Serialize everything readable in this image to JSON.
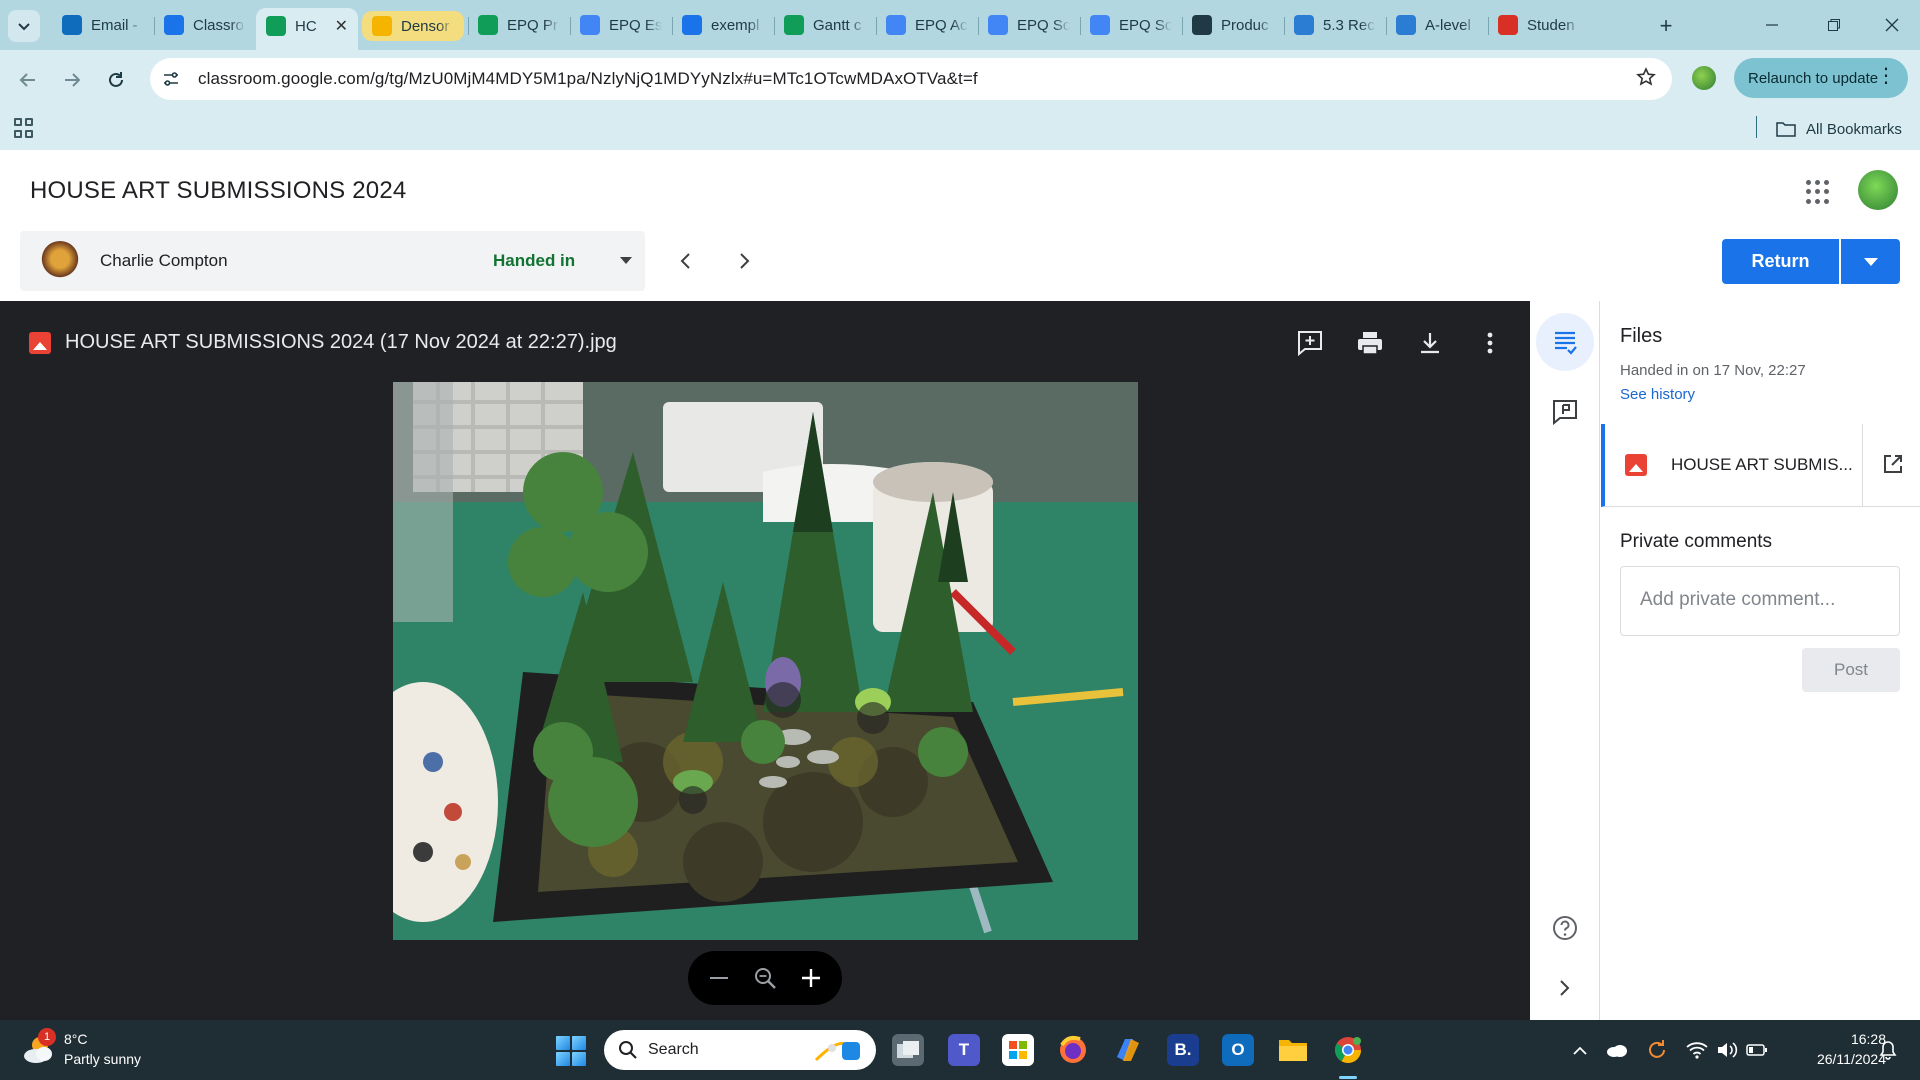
{
  "browser": {
    "tabs": [
      {
        "title": "Email -",
        "icon": "outlook-icon",
        "color": "#0f6cbd"
      },
      {
        "title": "Classro",
        "icon": "classroom-icon",
        "color": "#1a73e8"
      },
      {
        "title": "HC",
        "icon": "classroom-assignment-icon",
        "color": "#0f9d58",
        "active": true
      },
      {
        "title": "Densor",
        "icon": "slides-icon",
        "color": "#f4b400",
        "grouped": true
      },
      {
        "title": "EPQ Pr",
        "icon": "sheets-icon",
        "color": "#0f9d58"
      },
      {
        "title": "EPQ Es",
        "icon": "docs-icon",
        "color": "#4285f4"
      },
      {
        "title": "exempl",
        "icon": "pinterest-icon",
        "color": "#1a73e8"
      },
      {
        "title": "Gantt c",
        "icon": "sheets-icon",
        "color": "#0f9d58"
      },
      {
        "title": "EPQ Ac",
        "icon": "docs-icon",
        "color": "#4285f4"
      },
      {
        "title": "EPQ Sc",
        "icon": "docs-icon",
        "color": "#4285f4"
      },
      {
        "title": "EPQ Sc",
        "icon": "docs-icon",
        "color": "#4285f4"
      },
      {
        "title": "Produc",
        "icon": "search-q-icon",
        "color": "#1f3a44"
      },
      {
        "title": "5.3 Rec",
        "icon": "word-w-icon",
        "color": "#2b7cd3"
      },
      {
        "title": "A-level",
        "icon": "word-w-icon",
        "color": "#2b7cd3"
      },
      {
        "title": "Studen",
        "icon": "app-red-icon",
        "color": "#d93025"
      }
    ],
    "url": "classroom.google.com/g/tg/MzU0MjM4MDY5M1pa/NzlyNjQ1MDYyNzlx#u=MTc1OTcwMDAxOTVa&t=f",
    "relaunch_label": "Relaunch to update",
    "all_bookmarks_label": "All Bookmarks"
  },
  "header": {
    "title": "HOUSE ART SUBMISSIONS 2024"
  },
  "student": {
    "name": "Charlie Compton",
    "status": "Handed in",
    "status_color": "#137333"
  },
  "actions": {
    "return_label": "Return"
  },
  "viewer": {
    "file_name": "HOUSE ART SUBMISSIONS 2024 (17 Nov 2024 at 22:27).jpg",
    "background": "#202124"
  },
  "panel": {
    "files_heading": "Files",
    "handed_in_meta": "Handed in on 17 Nov, 22:27",
    "see_history": "See history",
    "attachment_name": "HOUSE ART SUBMIS...",
    "private_comments_heading": "Private comments",
    "comment_placeholder": "Add private comment...",
    "post_label": "Post"
  },
  "taskbar": {
    "weather_badge": "1",
    "weather_temp": "8°C",
    "weather_desc": "Partly sunny",
    "search_label": "Search",
    "time": "16:28",
    "date": "26/11/2024"
  },
  "colors": {
    "accent": "#1a73e8",
    "chrome": "#b3d7e0"
  }
}
